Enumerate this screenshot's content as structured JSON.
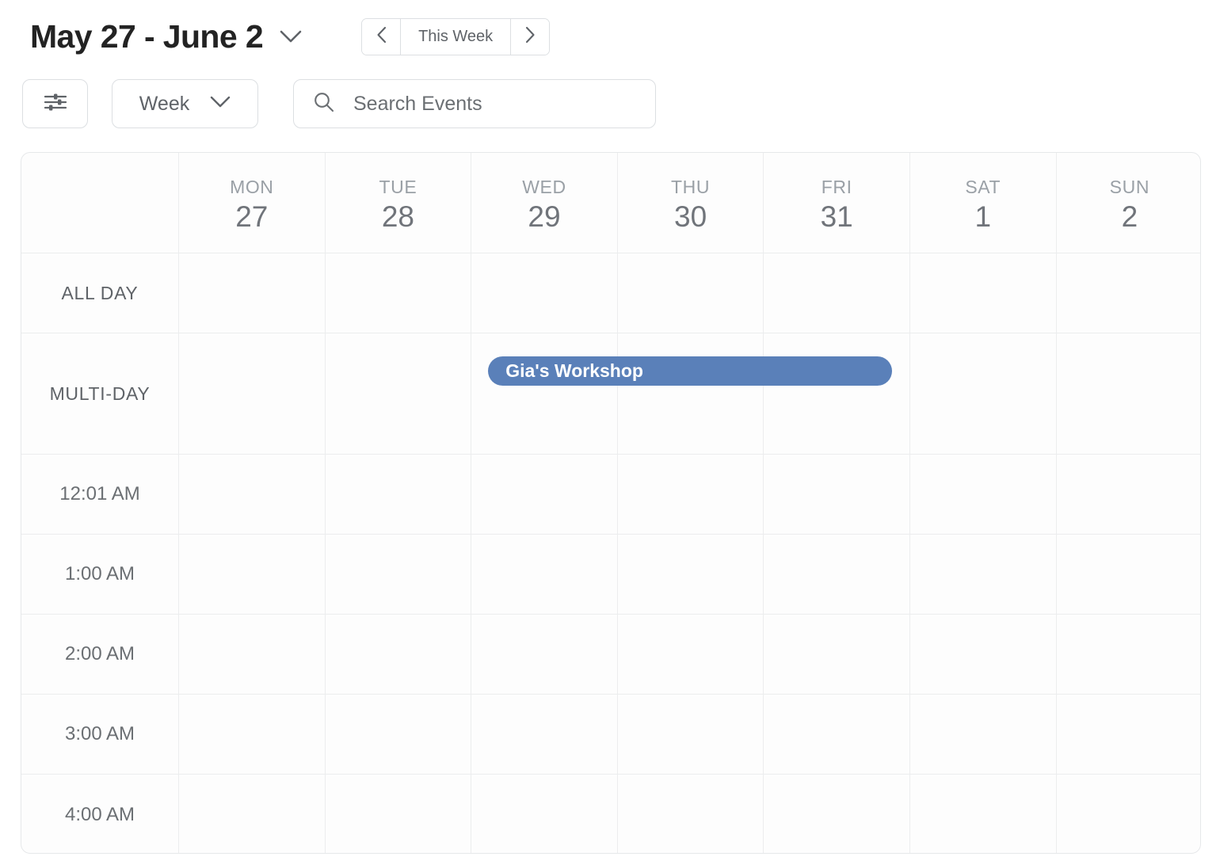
{
  "header": {
    "title": "May 27 - June 2",
    "title_chevron_icon": "chevron-down-icon",
    "nav": {
      "prev_icon": "chevron-left-icon",
      "label": "This Week",
      "next_icon": "chevron-right-icon"
    }
  },
  "controls": {
    "filter_icon": "filter-sliders-icon",
    "view_select": {
      "value": "Week",
      "chevron_icon": "chevron-down-icon"
    },
    "search": {
      "icon": "search-icon",
      "value": "",
      "placeholder": "Search Events"
    }
  },
  "calendar": {
    "corner_label": "",
    "days": [
      {
        "dow": "MON",
        "dom": "27"
      },
      {
        "dow": "TUE",
        "dom": "28"
      },
      {
        "dow": "WED",
        "dom": "29"
      },
      {
        "dow": "THU",
        "dom": "30"
      },
      {
        "dow": "FRI",
        "dom": "31"
      },
      {
        "dow": "SAT",
        "dom": "1"
      },
      {
        "dow": "SUN",
        "dom": "2"
      }
    ],
    "allday_label": "ALL DAY",
    "multiday_label": "MULTI-DAY",
    "time_slots": [
      "12:01 AM",
      "1:00 AM",
      "2:00 AM",
      "3:00 AM",
      "4:00 AM"
    ],
    "multiday_events": [
      {
        "title": "Gia's Workshop",
        "start_day_index": 2,
        "end_day_index": 4,
        "color": "#5a80b9",
        "text_color": "#ffffff"
      }
    ]
  },
  "colors": {
    "accent": "#5a80b9",
    "grid_line": "#ecedee",
    "border": "#dcdfe2",
    "title_text": "#232323",
    "muted_text": "#9aa0a6",
    "body_text": "#5f6368"
  }
}
